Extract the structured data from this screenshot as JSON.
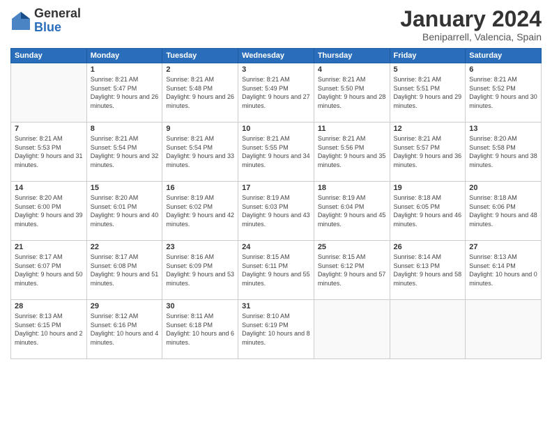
{
  "header": {
    "logo_general": "General",
    "logo_blue": "Blue",
    "month_title": "January 2024",
    "subtitle": "Beniparrell, Valencia, Spain"
  },
  "weekdays": [
    "Sunday",
    "Monday",
    "Tuesday",
    "Wednesday",
    "Thursday",
    "Friday",
    "Saturday"
  ],
  "weeks": [
    [
      {
        "day": "",
        "sunrise": "",
        "sunset": "",
        "daylight": "",
        "empty": true
      },
      {
        "day": "1",
        "sunrise": "Sunrise: 8:21 AM",
        "sunset": "Sunset: 5:47 PM",
        "daylight": "Daylight: 9 hours and 26 minutes."
      },
      {
        "day": "2",
        "sunrise": "Sunrise: 8:21 AM",
        "sunset": "Sunset: 5:48 PM",
        "daylight": "Daylight: 9 hours and 26 minutes."
      },
      {
        "day": "3",
        "sunrise": "Sunrise: 8:21 AM",
        "sunset": "Sunset: 5:49 PM",
        "daylight": "Daylight: 9 hours and 27 minutes."
      },
      {
        "day": "4",
        "sunrise": "Sunrise: 8:21 AM",
        "sunset": "Sunset: 5:50 PM",
        "daylight": "Daylight: 9 hours and 28 minutes."
      },
      {
        "day": "5",
        "sunrise": "Sunrise: 8:21 AM",
        "sunset": "Sunset: 5:51 PM",
        "daylight": "Daylight: 9 hours and 29 minutes."
      },
      {
        "day": "6",
        "sunrise": "Sunrise: 8:21 AM",
        "sunset": "Sunset: 5:52 PM",
        "daylight": "Daylight: 9 hours and 30 minutes."
      }
    ],
    [
      {
        "day": "7",
        "sunrise": "Sunrise: 8:21 AM",
        "sunset": "Sunset: 5:53 PM",
        "daylight": "Daylight: 9 hours and 31 minutes."
      },
      {
        "day": "8",
        "sunrise": "Sunrise: 8:21 AM",
        "sunset": "Sunset: 5:54 PM",
        "daylight": "Daylight: 9 hours and 32 minutes."
      },
      {
        "day": "9",
        "sunrise": "Sunrise: 8:21 AM",
        "sunset": "Sunset: 5:54 PM",
        "daylight": "Daylight: 9 hours and 33 minutes."
      },
      {
        "day": "10",
        "sunrise": "Sunrise: 8:21 AM",
        "sunset": "Sunset: 5:55 PM",
        "daylight": "Daylight: 9 hours and 34 minutes."
      },
      {
        "day": "11",
        "sunrise": "Sunrise: 8:21 AM",
        "sunset": "Sunset: 5:56 PM",
        "daylight": "Daylight: 9 hours and 35 minutes."
      },
      {
        "day": "12",
        "sunrise": "Sunrise: 8:21 AM",
        "sunset": "Sunset: 5:57 PM",
        "daylight": "Daylight: 9 hours and 36 minutes."
      },
      {
        "day": "13",
        "sunrise": "Sunrise: 8:20 AM",
        "sunset": "Sunset: 5:58 PM",
        "daylight": "Daylight: 9 hours and 38 minutes."
      }
    ],
    [
      {
        "day": "14",
        "sunrise": "Sunrise: 8:20 AM",
        "sunset": "Sunset: 6:00 PM",
        "daylight": "Daylight: 9 hours and 39 minutes."
      },
      {
        "day": "15",
        "sunrise": "Sunrise: 8:20 AM",
        "sunset": "Sunset: 6:01 PM",
        "daylight": "Daylight: 9 hours and 40 minutes."
      },
      {
        "day": "16",
        "sunrise": "Sunrise: 8:19 AM",
        "sunset": "Sunset: 6:02 PM",
        "daylight": "Daylight: 9 hours and 42 minutes."
      },
      {
        "day": "17",
        "sunrise": "Sunrise: 8:19 AM",
        "sunset": "Sunset: 6:03 PM",
        "daylight": "Daylight: 9 hours and 43 minutes."
      },
      {
        "day": "18",
        "sunrise": "Sunrise: 8:19 AM",
        "sunset": "Sunset: 6:04 PM",
        "daylight": "Daylight: 9 hours and 45 minutes."
      },
      {
        "day": "19",
        "sunrise": "Sunrise: 8:18 AM",
        "sunset": "Sunset: 6:05 PM",
        "daylight": "Daylight: 9 hours and 46 minutes."
      },
      {
        "day": "20",
        "sunrise": "Sunrise: 8:18 AM",
        "sunset": "Sunset: 6:06 PM",
        "daylight": "Daylight: 9 hours and 48 minutes."
      }
    ],
    [
      {
        "day": "21",
        "sunrise": "Sunrise: 8:17 AM",
        "sunset": "Sunset: 6:07 PM",
        "daylight": "Daylight: 9 hours and 50 minutes."
      },
      {
        "day": "22",
        "sunrise": "Sunrise: 8:17 AM",
        "sunset": "Sunset: 6:08 PM",
        "daylight": "Daylight: 9 hours and 51 minutes."
      },
      {
        "day": "23",
        "sunrise": "Sunrise: 8:16 AM",
        "sunset": "Sunset: 6:09 PM",
        "daylight": "Daylight: 9 hours and 53 minutes."
      },
      {
        "day": "24",
        "sunrise": "Sunrise: 8:15 AM",
        "sunset": "Sunset: 6:11 PM",
        "daylight": "Daylight: 9 hours and 55 minutes."
      },
      {
        "day": "25",
        "sunrise": "Sunrise: 8:15 AM",
        "sunset": "Sunset: 6:12 PM",
        "daylight": "Daylight: 9 hours and 57 minutes."
      },
      {
        "day": "26",
        "sunrise": "Sunrise: 8:14 AM",
        "sunset": "Sunset: 6:13 PM",
        "daylight": "Daylight: 9 hours and 58 minutes."
      },
      {
        "day": "27",
        "sunrise": "Sunrise: 8:13 AM",
        "sunset": "Sunset: 6:14 PM",
        "daylight": "Daylight: 10 hours and 0 minutes."
      }
    ],
    [
      {
        "day": "28",
        "sunrise": "Sunrise: 8:13 AM",
        "sunset": "Sunset: 6:15 PM",
        "daylight": "Daylight: 10 hours and 2 minutes."
      },
      {
        "day": "29",
        "sunrise": "Sunrise: 8:12 AM",
        "sunset": "Sunset: 6:16 PM",
        "daylight": "Daylight: 10 hours and 4 minutes."
      },
      {
        "day": "30",
        "sunrise": "Sunrise: 8:11 AM",
        "sunset": "Sunset: 6:18 PM",
        "daylight": "Daylight: 10 hours and 6 minutes."
      },
      {
        "day": "31",
        "sunrise": "Sunrise: 8:10 AM",
        "sunset": "Sunset: 6:19 PM",
        "daylight": "Daylight: 10 hours and 8 minutes."
      },
      {
        "day": "",
        "sunrise": "",
        "sunset": "",
        "daylight": "",
        "empty": true
      },
      {
        "day": "",
        "sunrise": "",
        "sunset": "",
        "daylight": "",
        "empty": true
      },
      {
        "day": "",
        "sunrise": "",
        "sunset": "",
        "daylight": "",
        "empty": true
      }
    ]
  ]
}
